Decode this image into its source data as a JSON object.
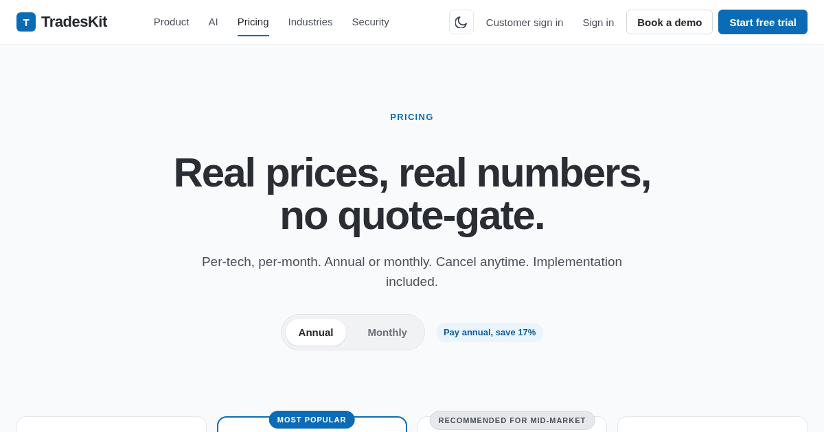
{
  "brand": {
    "mark": "T",
    "name": "TradesKit"
  },
  "nav": [
    {
      "label": "Product",
      "selected": false
    },
    {
      "label": "AI",
      "selected": false
    },
    {
      "label": "Pricing",
      "selected": true
    },
    {
      "label": "Industries",
      "selected": false
    },
    {
      "label": "Security",
      "selected": false
    }
  ],
  "header_actions": {
    "customer_sign_in": "Customer sign in",
    "sign_in": "Sign in",
    "book_demo": "Book a demo",
    "start_trial": "Start free trial"
  },
  "hero": {
    "eyebrow": "PRICING",
    "title": "Real prices, real numbers, no quote-gate.",
    "subtitle": "Per-tech, per-month. Annual or monthly. Cancel anytime. Implementation included.",
    "billing_toggle": [
      {
        "label": "Annual",
        "selected": true
      },
      {
        "label": "Monthly",
        "selected": false
      }
    ],
    "savings_badge": "Pay annual, save 17%"
  },
  "plans": [
    {
      "highlighted": false
    },
    {
      "highlighted": true,
      "badge": {
        "text": "MOST POPULAR",
        "kind": "primary"
      }
    },
    {
      "highlighted": false,
      "badge": {
        "text": "RECOMMENDED FOR MID-MARKET",
        "kind": "neutral"
      }
    },
    {
      "highlighted": false
    }
  ]
}
